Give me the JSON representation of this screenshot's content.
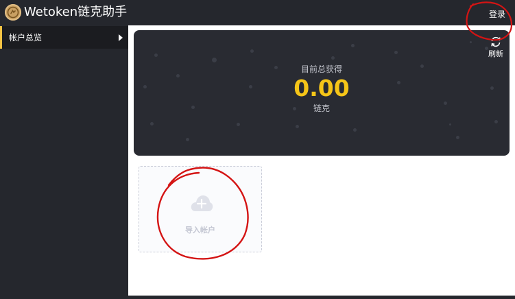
{
  "header": {
    "app_title": "Wetoken链克助手",
    "login_label": "登录",
    "logo_icon": "coin-logo-icon"
  },
  "sidebar": {
    "items": [
      {
        "label": "帐户总览",
        "icon": "chevron-right-icon",
        "active": true
      }
    ]
  },
  "summary": {
    "total_label": "目前总获得",
    "total_value": "0.00",
    "unit_label": "链克",
    "refresh_label": "刷新"
  },
  "import_card": {
    "label": "导入帐户",
    "icon": "cloud-plus-icon"
  },
  "colors": {
    "accent": "#f5c518",
    "dark_bg": "#25272d",
    "banner_bg": "#292b32",
    "annotation_red": "#d41414"
  }
}
